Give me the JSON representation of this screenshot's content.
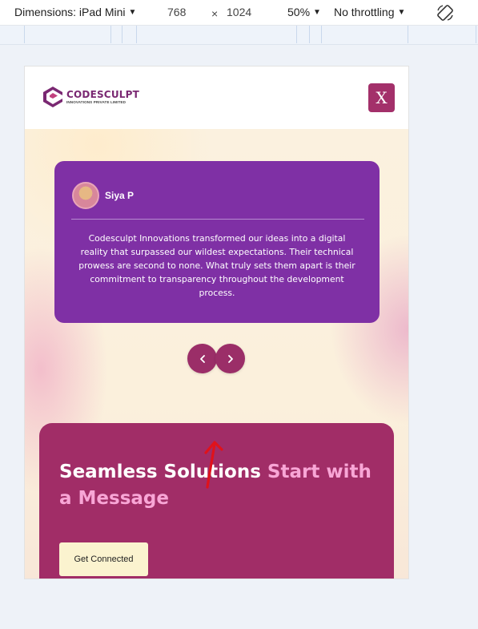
{
  "devtools": {
    "dimensions_label": "Dimensions: iPad Mini",
    "width": "768",
    "times": "×",
    "height": "1024",
    "zoom": "50%",
    "throttling": "No throttling",
    "rotate_icon": "rotate-icon"
  },
  "site": {
    "logo_name": "CODESCULPT",
    "logo_sub": "INNOVATIONS PRIVATE LIMITED",
    "close_label": "X"
  },
  "testimonial": {
    "author": "Siya P",
    "quote": "Codesculpt Innovations transformed our ideas into a digital reality that surpassed our wildest expectations. Their technical prowess are second to none. What truly sets them apart is their commitment to transparency throughout the development process."
  },
  "carousel": {
    "prev_icon": "chevron-left-icon",
    "next_icon": "chevron-right-icon"
  },
  "cta": {
    "heading_white": "Seamless Solutions ",
    "heading_pink": "Start with a Message",
    "button_label": "Get Connected"
  },
  "colors": {
    "brand_purple": "#7f30a5",
    "brand_magenta": "#a12d67",
    "annotation_red": "#e0121b"
  }
}
